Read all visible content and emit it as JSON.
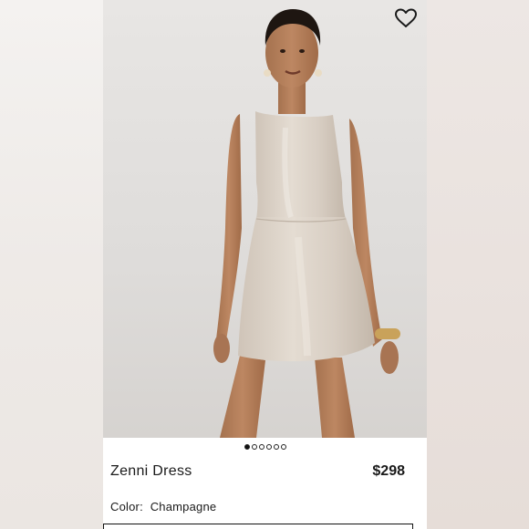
{
  "product": {
    "name": "Zenni Dress",
    "price": "$298",
    "color_label": "Color:",
    "color_value": "Champagne"
  },
  "carousel": {
    "total": 6,
    "active_index": 0
  },
  "icons": {
    "favorite": "heart-outline-icon"
  },
  "colors": {
    "background": "#ffffff",
    "text": "#1a1a1a",
    "dress": "#d6cdc3"
  }
}
